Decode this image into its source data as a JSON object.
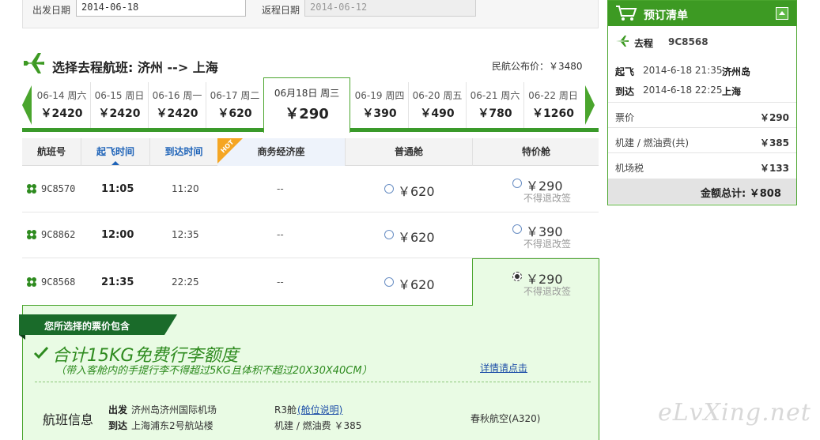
{
  "search": {
    "depart_label": "出发日期",
    "depart_value": "2014-06-18",
    "return_label": "返程日期",
    "return_value": "2014-06-12"
  },
  "heading": {
    "title": "选择去程航班: 济州 --> 上海",
    "public_price": "民航公布价：￥3480"
  },
  "date_tabs": [
    {
      "date": "06-14 周六",
      "price": "￥2420"
    },
    {
      "date": "06-15 周日",
      "price": "￥2420"
    },
    {
      "date": "06-16 周一",
      "price": "￥2420"
    },
    {
      "date": "06-17 周二",
      "price": "￥620"
    },
    {
      "date": "06月18日 周三",
      "price": "￥290",
      "active": true
    },
    {
      "date": "06-19 周四",
      "price": "￥390"
    },
    {
      "date": "06-20 周五",
      "price": "￥490"
    },
    {
      "date": "06-21 周六",
      "price": "￥780"
    },
    {
      "date": "06-22 周日",
      "price": "￥1260"
    }
  ],
  "table": {
    "headers": {
      "flight_no": "航班号",
      "depart_time": "起飞时间",
      "arrive_time": "到达时间",
      "hot": "HOT",
      "business": "商务经济座",
      "economy": "普通舱",
      "special": "特价舱"
    },
    "rows": [
      {
        "flight": "9C8570",
        "dep": "11:05",
        "arr": "11:20",
        "business": "--",
        "economy": "￥620",
        "special": "￥290",
        "special_note": "不得退改签"
      },
      {
        "flight": "9C8862",
        "dep": "12:00",
        "arr": "12:35",
        "business": "--",
        "economy": "￥620",
        "special": "￥390",
        "special_note": "不得退改签"
      },
      {
        "flight": "9C8568",
        "dep": "21:35",
        "arr": "22:25",
        "business": "--",
        "economy": "￥620",
        "special": "￥290",
        "special_note": "不得退改签"
      }
    ]
  },
  "detail": {
    "ribbon": "您所选择的票价包含",
    "luggage_title": "合计15KG免费行李额度",
    "luggage_sub": "（带入客舱内的手提行李不得超过5KG且体积不超过20X30X40CM）",
    "more_link": "详情请点击",
    "info_title": "航班信息",
    "depart_label": "出发",
    "depart_airport": "济州岛济州国际机场",
    "arrive_label": "到达",
    "arrive_airport": "上海浦东2号航站楼",
    "cabin": "R3舱",
    "cabin_link": "(舱位说明)",
    "fee": "机建 / 燃油费 ￥385",
    "aircraft": "春秋航空(A320)"
  },
  "order": {
    "title": "预订清单",
    "trip_label": "去程",
    "trip_flight": "9C8568",
    "dep_label": "起飞",
    "dep_time": "2014-6-18 21:35",
    "dep_city": "济州岛",
    "arr_label": "到达",
    "arr_time": "2014-6-18 22:25",
    "arr_city": "上海",
    "fare_label": "票价",
    "fare": "￥290",
    "tax_label": "机建 / 燃油费(共)",
    "tax": "￥385",
    "airport_label": "机场税",
    "airport_tax": "￥133",
    "total": "金额总计: ￥808"
  },
  "watermark": "eLvXing.net",
  "colors": {
    "accent": "#3d9a23",
    "link": "#1e63b8",
    "selected_bg": "#e9fbe4"
  }
}
